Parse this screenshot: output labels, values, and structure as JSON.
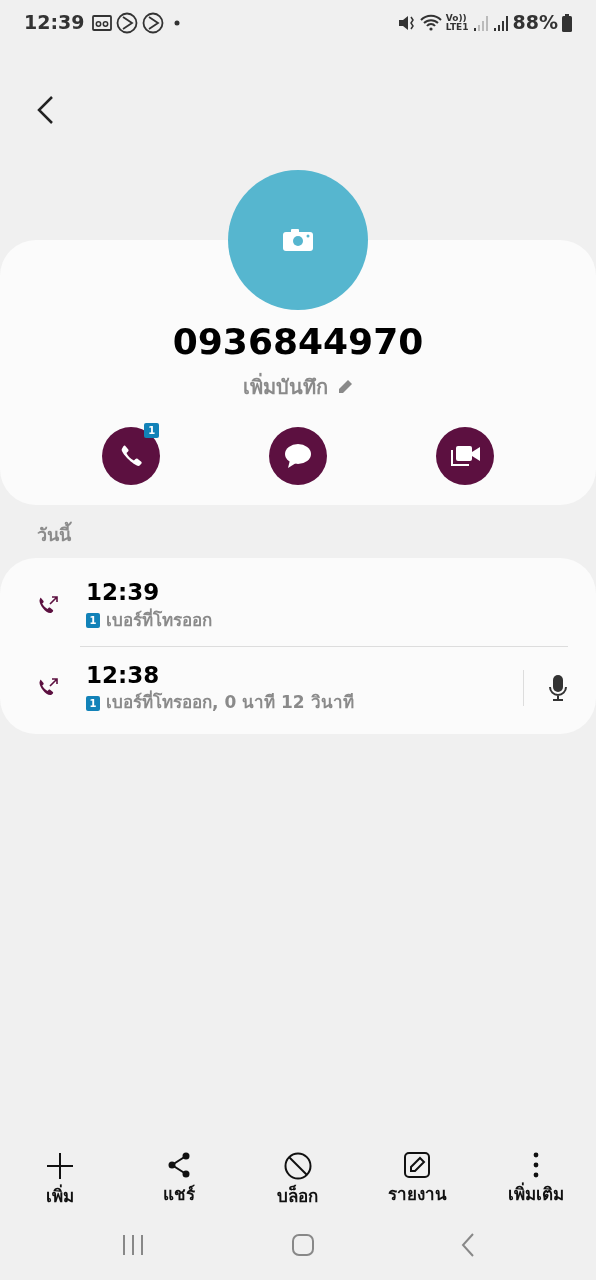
{
  "status_bar": {
    "time": "12:39",
    "network": "Vo))\nLTE1",
    "battery": "88%"
  },
  "contact": {
    "number": "0936844970",
    "note_label": "เพิ่มบันทึก"
  },
  "actions": [
    {
      "kind": "call",
      "sim": "1"
    },
    {
      "kind": "message"
    },
    {
      "kind": "video"
    }
  ],
  "section_title": "วันนี้",
  "calls": [
    {
      "time": "12:39",
      "sim": "1",
      "detail": "เบอร์ที่โทรออก",
      "recording": false
    },
    {
      "time": "12:38",
      "sim": "1",
      "detail": "เบอร์ที่โทรออก, 0 นาที 12 วินาที",
      "recording": true
    }
  ],
  "bottom_actions": [
    {
      "kind": "add",
      "label": "เพิ่ม"
    },
    {
      "kind": "share",
      "label": "แชร์"
    },
    {
      "kind": "block",
      "label": "บล็อก"
    },
    {
      "kind": "report",
      "label": "รายงาน"
    },
    {
      "kind": "more",
      "label": "เพิ่มเติม"
    }
  ]
}
